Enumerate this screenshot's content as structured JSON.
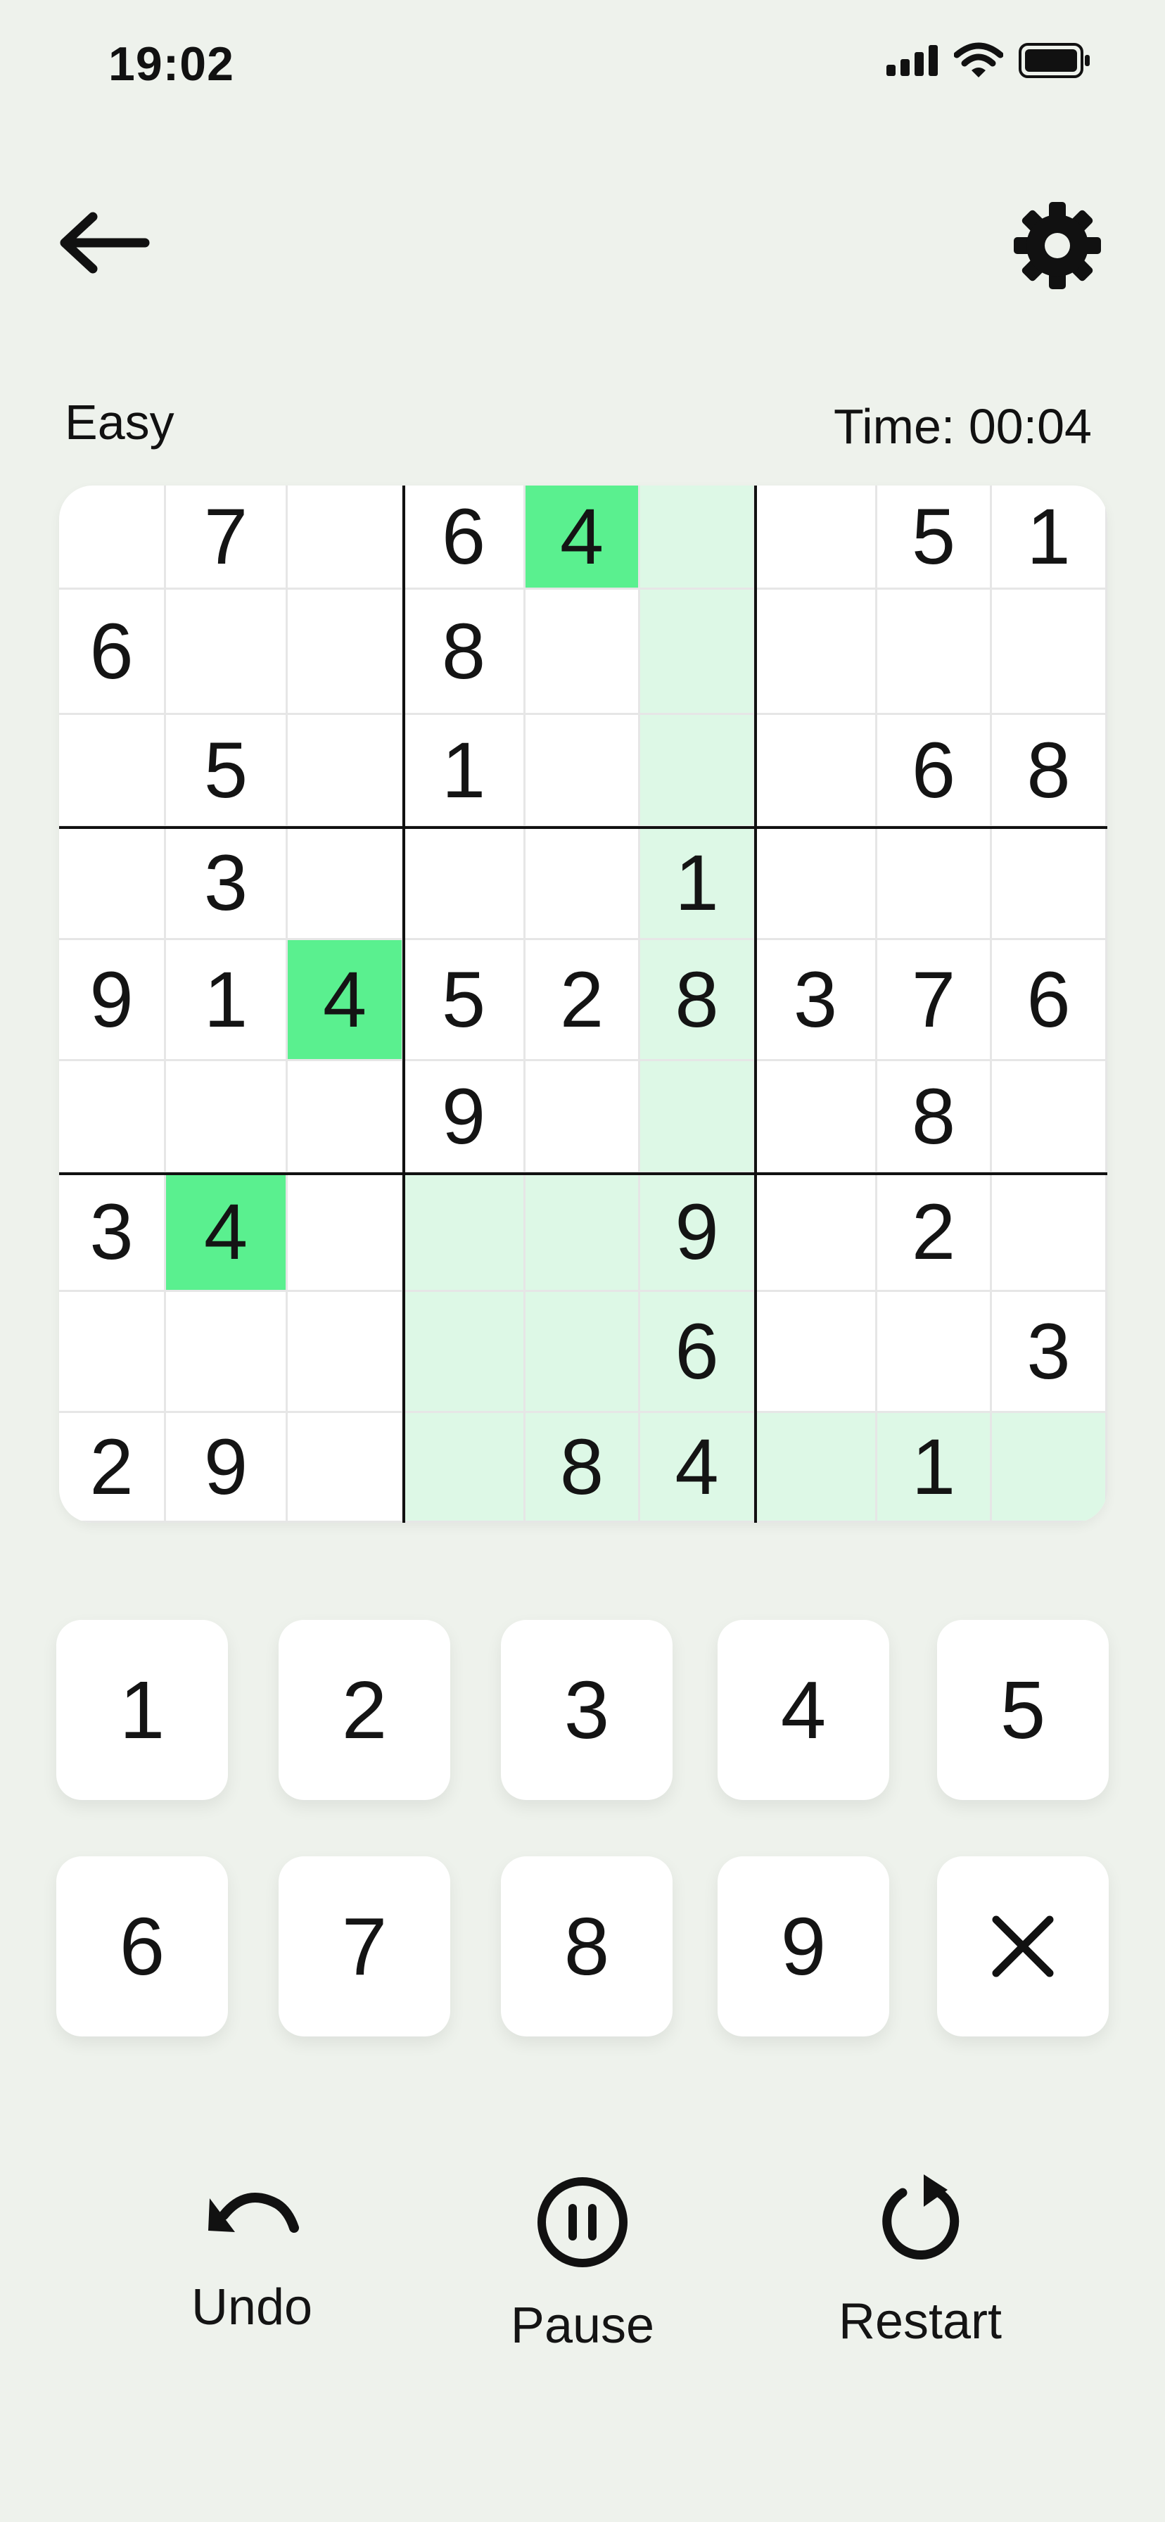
{
  "status_bar": {
    "time": "19:02"
  },
  "header": {
    "back_icon": "arrow-left-icon",
    "settings_icon": "gear-icon"
  },
  "game": {
    "difficulty": "Easy",
    "timer_label": "Time: 00:04"
  },
  "board": {
    "rows": [
      [
        "",
        "7",
        "",
        "6",
        "4",
        "",
        "",
        "5",
        "1"
      ],
      [
        "6",
        "",
        "",
        "8",
        "",
        "",
        "",
        "",
        ""
      ],
      [
        "",
        "5",
        "",
        "1",
        "",
        "",
        "",
        "6",
        "8"
      ],
      [
        "",
        "3",
        "",
        "",
        "",
        "1",
        "",
        "",
        ""
      ],
      [
        "9",
        "1",
        "4",
        "5",
        "2",
        "8",
        "3",
        "7",
        "6"
      ],
      [
        "",
        "",
        "",
        "9",
        "",
        "",
        "",
        "8",
        ""
      ],
      [
        "3",
        "4",
        "",
        "",
        "",
        "9",
        "",
        "2",
        ""
      ],
      [
        "",
        "",
        "",
        "",
        "",
        "6",
        "",
        "",
        "3"
      ],
      [
        "2",
        "9",
        "",
        "",
        "8",
        "4",
        "",
        "1",
        ""
      ]
    ],
    "selected_cell": "row 9, column 6",
    "highlight_color": "#ddf8e6",
    "match_color": "#5af08f"
  },
  "keypad": {
    "keys": [
      "1",
      "2",
      "3",
      "4",
      "5",
      "6",
      "7",
      "8",
      "9"
    ],
    "erase_icon": "close-icon"
  },
  "actions": {
    "undo": "Undo",
    "pause": "Pause",
    "restart": "Restart"
  }
}
